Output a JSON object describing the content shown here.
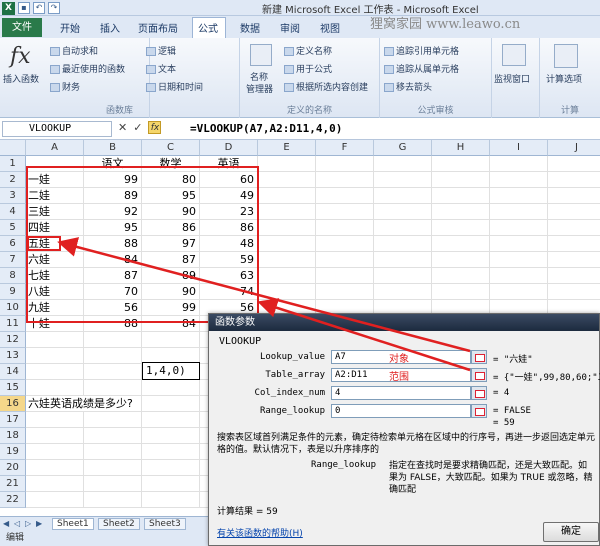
{
  "window": {
    "title": "新建 Microsoft Excel 工作表 - Microsoft Excel",
    "watermark": "狸窝家园 www.leawo.cn",
    "app_icon": "X"
  },
  "tabs": [
    "文件",
    "开始",
    "插入",
    "页面布局",
    "公式",
    "数据",
    "审阅",
    "视图"
  ],
  "active_tab": "公式",
  "ribbon": {
    "insert_function": "插入函数",
    "autosum": "自动求和",
    "recent": "最近使用的函数",
    "financial": "财务",
    "logical": "逻辑",
    "text": "文本",
    "datetime": "日期和时间",
    "library_group": "函数库",
    "name_manager_1": "名称",
    "name_manager_2": "管理器",
    "define_name": "定义名称",
    "use_in_formula": "用于公式",
    "create_from_sel": "根据所选内容创建",
    "names_group": "定义的名称",
    "trace_precedents": "追踪引用单元格",
    "trace_dependents": "追踪从属单元格",
    "remove_arrows": "移去箭头",
    "auditing_group": "公式审核",
    "watch_window": "监视窗口",
    "calc_options": "计算选项",
    "calc_group": "计算"
  },
  "formula_bar": {
    "name_box": "VLOOKUP",
    "formula": "=VLOOKUP(A7,A2:D11,4,0)",
    "fx": "fx",
    "cancel": "✕",
    "enter": "✓"
  },
  "columns": [
    "A",
    "B",
    "C",
    "D",
    "E",
    "F",
    "G",
    "H",
    "I",
    "J"
  ],
  "rows": [
    "1",
    "2",
    "3",
    "4",
    "5",
    "6",
    "7",
    "8",
    "9",
    "10",
    "11",
    "12",
    "13",
    "14",
    "15",
    "16",
    "17",
    "18",
    "19",
    "20",
    "21",
    "22"
  ],
  "table": {
    "headers": [
      "",
      "语文",
      "数学",
      "英语"
    ],
    "data": [
      [
        "一娃",
        "99",
        "80",
        "60"
      ],
      [
        "二娃",
        "89",
        "95",
        "49"
      ],
      [
        "三娃",
        "92",
        "90",
        "23"
      ],
      [
        "四娃",
        "95",
        "86",
        "86"
      ],
      [
        "五娃",
        "88",
        "97",
        "48"
      ],
      [
        "六娃",
        "84",
        "87",
        "59"
      ],
      [
        "七娃",
        "87",
        "89",
        "63"
      ],
      [
        "八娃",
        "70",
        "90",
        "74"
      ],
      [
        "九娃",
        "56",
        "99",
        "56"
      ],
      [
        "十娃",
        "88",
        "84",
        "81"
      ]
    ]
  },
  "question": "六娃英语成绩是多少?",
  "answer_cell": "1,4,0)",
  "sheet_tabs": [
    "Sheet1",
    "Sheet2",
    "Sheet3"
  ],
  "status": "编辑",
  "dialog": {
    "title": "函数参数",
    "function": "VLOOKUP",
    "args": [
      {
        "label": "Lookup_value",
        "value": "A7",
        "note": "对象",
        "result": "= \"六娃\""
      },
      {
        "label": "Table_array",
        "value": "A2:D11",
        "note": "范围",
        "result": "= {\"一娃\",99,80,60;\"二"
      },
      {
        "label": "Col_index_num",
        "value": "4",
        "note": "",
        "result": "= 4"
      },
      {
        "label": "Range_lookup",
        "value": "0",
        "note": "",
        "result": "= FALSE"
      }
    ],
    "eq_result": "= 59",
    "description": "搜索表区域首列满足条件的元素，确定待检索单元格在区域中的行序号，再进一步返回选定单元格的值。默认情况下，表是以升序排序的",
    "arg_name": "Range_lookup",
    "arg_description": "指定在查找时是要求精确匹配，还是大致匹配。如果为 FALSE，大致匹配。如果为 TRUE 或忽略，精确匹配",
    "calc_result": "计算结果 =  59",
    "help_link": "有关该函数的帮助(H)",
    "ok": "确定"
  }
}
